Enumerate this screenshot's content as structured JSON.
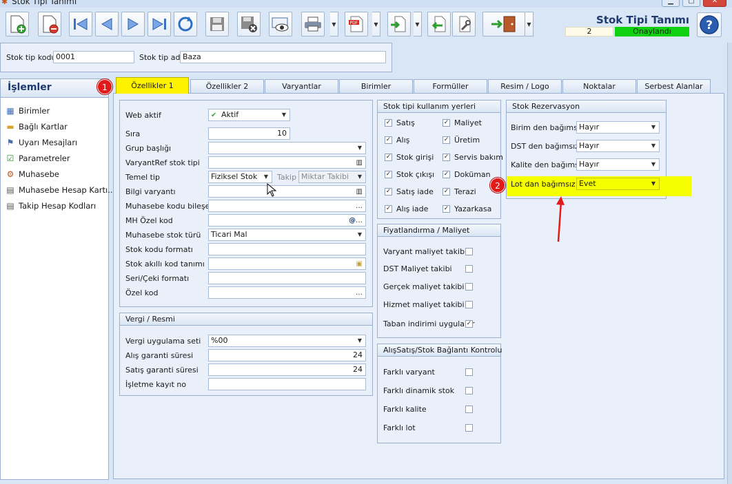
{
  "window": {
    "title": "Stok Tipi Tanımı"
  },
  "form": {
    "title": "Stok Tipi Tanımı",
    "record_no": "2",
    "status": "Onaylandı"
  },
  "header": {
    "code_label": "Stok tip kodu",
    "code_value": "0001",
    "name_label": "Stok tip adı",
    "name_value": "Baza"
  },
  "sidebar": {
    "title": "İşlemler",
    "items": [
      {
        "label": "Birimler"
      },
      {
        "label": "Bağlı Kartlar"
      },
      {
        "label": "Uyarı Mesajları"
      },
      {
        "label": "Parametreler"
      },
      {
        "label": "Muhasebe"
      },
      {
        "label": "Muhasebe Hesap Kartı..."
      },
      {
        "label": "Takip Hesap Kodları"
      }
    ]
  },
  "tabs": [
    {
      "label": "Özellikler 1"
    },
    {
      "label": "Özellikler 2"
    },
    {
      "label": "Varyantlar"
    },
    {
      "label": "Birimler"
    },
    {
      "label": "Formüller"
    },
    {
      "label": "Resim / Logo"
    },
    {
      "label": "Noktalar"
    },
    {
      "label": "Serbest Alanlar"
    }
  ],
  "props": {
    "web_aktif_label": "Web aktif",
    "web_aktif_value": "Aktif",
    "sira_label": "Sıra",
    "sira_value": "10",
    "grup_label": "Grup başlığı",
    "varyantref_label": "VaryantRef stok tipi",
    "temel_label": "Temel tip",
    "temel_value": "Fiziksel Stok",
    "takip_label": "Takip",
    "takip_value": "Miktar Takibi",
    "bilgi_label": "Bilgi varyantı",
    "muh_bilesen_label": "Muhasebe kodu bileşeni",
    "mh_ozel_label": "MH Özel kod",
    "muh_tur_label": "Muhasebe stok türü",
    "muh_tur_value": "Ticari Mal",
    "stok_format_label": "Stok kodu formatı",
    "akilli_label": "Stok akıllı kod tanımı",
    "seri_label": "Seri/Çeki formatı",
    "ozel_label": "Özel kod"
  },
  "vergi": {
    "title": "Vergi / Resmi",
    "uyg_label": "Vergi uygulama seti",
    "uyg_value": "%00",
    "alis_label": "Alış garanti süresi",
    "alis_value": "24",
    "satis_label": "Satış garanti süresi",
    "satis_value": "24",
    "isletme_label": "İşletme kayıt no"
  },
  "usage": {
    "title": "Stok tipi kullanım yerleri",
    "items": [
      {
        "label": "Satış",
        "checked": true
      },
      {
        "label": "Maliyet",
        "checked": true
      },
      {
        "label": "Alış",
        "checked": true
      },
      {
        "label": "Üretim",
        "checked": true
      },
      {
        "label": "Stok girişi",
        "checked": true
      },
      {
        "label": "Servis bakım",
        "checked": true
      },
      {
        "label": "Stok çıkışı",
        "checked": true
      },
      {
        "label": "Doküman",
        "checked": true
      },
      {
        "label": "Satış iade",
        "checked": true
      },
      {
        "label": "Terazi",
        "checked": true
      },
      {
        "label": "Alış iade",
        "checked": true
      },
      {
        "label": "Yazarkasa",
        "checked": true
      }
    ]
  },
  "pricing": {
    "title": "Fiyatlandırma / Maliyet",
    "items": [
      {
        "label": "Varyant maliyet takibi",
        "checked": false
      },
      {
        "label": "DST Maliyet takibi",
        "checked": false
      },
      {
        "label": "Gerçek maliyet takibi",
        "checked": false
      },
      {
        "label": "Hizmet maliyet takibi",
        "checked": false
      },
      {
        "label": "Taban indirimi uygulanır",
        "checked": true
      }
    ]
  },
  "link_control": {
    "title": "AlışSatış/Stok Bağlantı Kontrolu",
    "items": [
      {
        "label": "Farklı varyant",
        "checked": false
      },
      {
        "label": "Farklı dinamik stok",
        "checked": false
      },
      {
        "label": "Farklı kalite",
        "checked": false
      },
      {
        "label": "Farklı lot",
        "checked": false
      }
    ]
  },
  "reservation": {
    "title": "Stok Rezervasyon",
    "birim_label": "Birim den bağımsız",
    "birim_value": "Hayır",
    "dst_label": "DST den bağımsız",
    "dst_value": "Hayır",
    "kalite_label": "Kalite den bağımsız",
    "kalite_value": "Hayır",
    "lot_label": "Lot dan bağımsız",
    "lot_value": "Evet"
  },
  "annotations": {
    "badge1": "1",
    "badge2": "2"
  },
  "colors": {
    "highlight": "#f6ff00",
    "status_green": "#0fd10f",
    "badge_red": "#e11a1a",
    "title_blue": "#1f3a6e"
  }
}
